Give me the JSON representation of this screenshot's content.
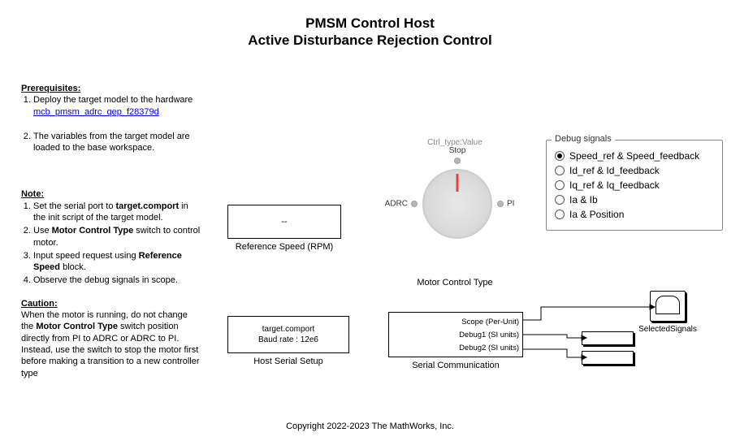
{
  "title": {
    "line1": "PMSM Control Host",
    "line2": "Active Disturbance Rejection Control"
  },
  "prereq": {
    "heading": "Prerequisites:",
    "item1": "Deploy the target model to the hardware",
    "link": "mcb_pmsm_adrc_qep_f28379d",
    "item2": "The variables from the target model are loaded to the base workspace."
  },
  "note": {
    "heading": "Note:",
    "item1_a": "Set the serial port to ",
    "item1_b": "target.comport",
    "item1_c": " in the init script of the target model.",
    "item2_a": "Use ",
    "item2_b": "Motor Control Type",
    "item2_c": " switch to control motor.",
    "item3_a": "Input speed request using ",
    "item3_b": "Reference Speed",
    "item3_c": " block.",
    "item4": "Observe the debug signals in scope."
  },
  "caution": {
    "heading": "Caution:",
    "body_a": "When the motor is running, do not change the ",
    "body_b": "Motor Control Type",
    "body_c": " switch position directly from PI to ADRC or ADRC to PI. Instead, use the switch to stop the motor first before making a transition to a new controller type"
  },
  "ref_speed": {
    "value": "--",
    "label": "Reference Speed (RPM)"
  },
  "knob": {
    "ctrl_type_tag": "Ctrl_type:Value",
    "stop": "Stop",
    "adrc": "ADRC",
    "pi": "PI",
    "label": "Motor Control Type"
  },
  "debug": {
    "legend": "Debug signals",
    "options": [
      "Speed_ref & Speed_feedback",
      "Id_ref & Id_feedback",
      "Iq_ref & Iq_feedback",
      "Ia & Ib",
      "Ia & Position"
    ],
    "selected": 0
  },
  "host_serial": {
    "line1": "target.comport",
    "line2": "Baud rate : 12e6",
    "label": "Host Serial Setup"
  },
  "serial_comm": {
    "ports": [
      "Scope (Per-Unit)",
      "Debug1 (SI units)",
      "Debug2 (SI units)"
    ],
    "label": "Serial Communication"
  },
  "scope": {
    "label": "SelectedSignals"
  },
  "copyright": "Copyright 2022-2023 The MathWorks, Inc."
}
